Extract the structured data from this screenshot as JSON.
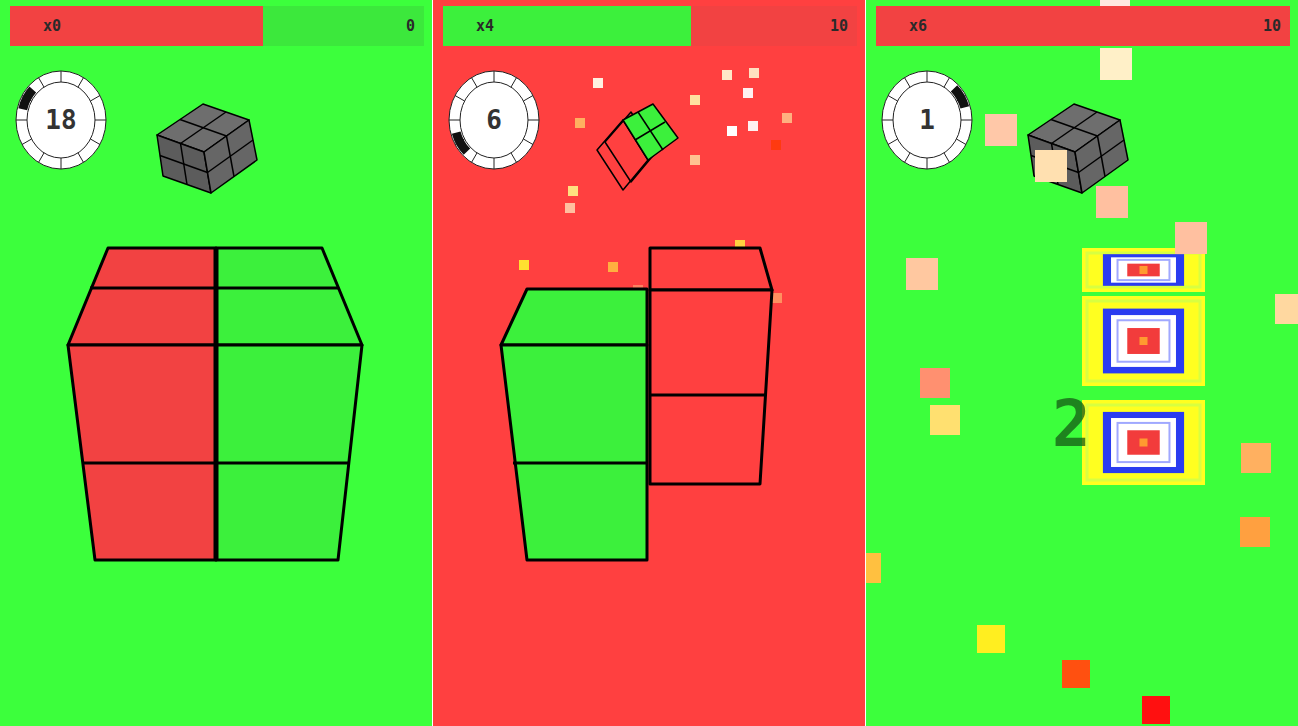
{
  "panels": [
    {
      "background": "#3cff3c",
      "bar": {
        "multiplier": "x0",
        "score": "0",
        "level": 0.61,
        "fill_color": "#f24242",
        "track_color": "#3ce83c"
      },
      "timer": {
        "value": "18",
        "level": 0.79
      },
      "kind": "cube"
    },
    {
      "background": "#ff4040",
      "bar": {
        "multiplier": "x4",
        "score": "10",
        "level": 0.6,
        "fill_color": "#3cf03c",
        "track_color": "#f24242"
      },
      "timer": {
        "value": "6",
        "level": 0.62
      },
      "kind": "split"
    },
    {
      "background": "#3cff3c",
      "bar": {
        "multiplier": "x6",
        "score": "10",
        "level": 1,
        "fill_color": "#f24242",
        "track_color": "#f24242"
      },
      "timer": {
        "value": "1",
        "level": 0.12
      },
      "kind": "targets",
      "overlay_number": "2"
    }
  ]
}
